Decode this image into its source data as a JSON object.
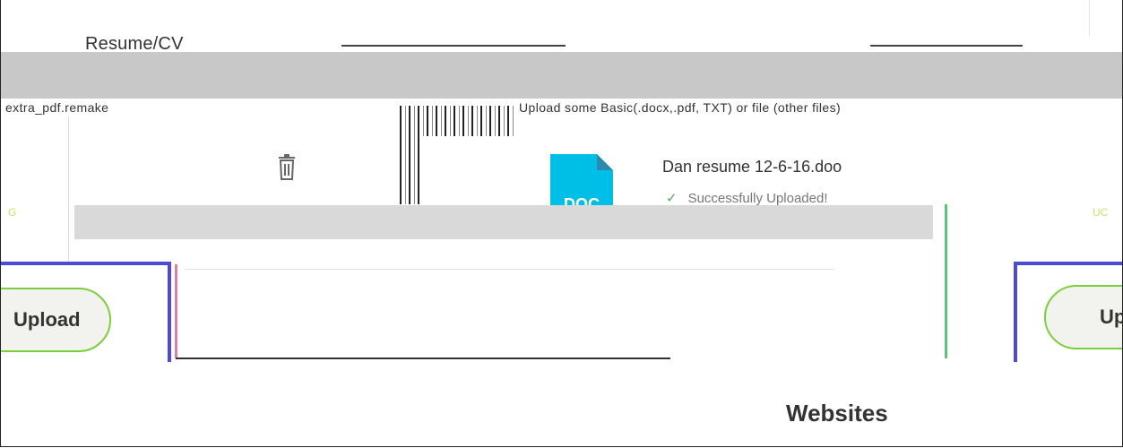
{
  "section": {
    "title": "Resume/CV"
  },
  "instructions": {
    "left_text": "extra_pdf.remake",
    "right_text": "Upload some Basic(.docx,.pdf, TXT) or file (other files)"
  },
  "file": {
    "name": "Dan resume 12-6-16.doo",
    "status": "Successfully Uploaded!",
    "type_label": "DOC",
    "icon": "document-icon",
    "delete_icon": "trash-icon"
  },
  "buttons": {
    "upload_left_label": "Upload",
    "upload_right_label": "Up"
  },
  "websites": {
    "title": "Websites"
  },
  "colors": {
    "accent_blue": "#4b4bd6",
    "accent_green": "#7ccf3a",
    "doc_icon": "#00bfe6"
  }
}
